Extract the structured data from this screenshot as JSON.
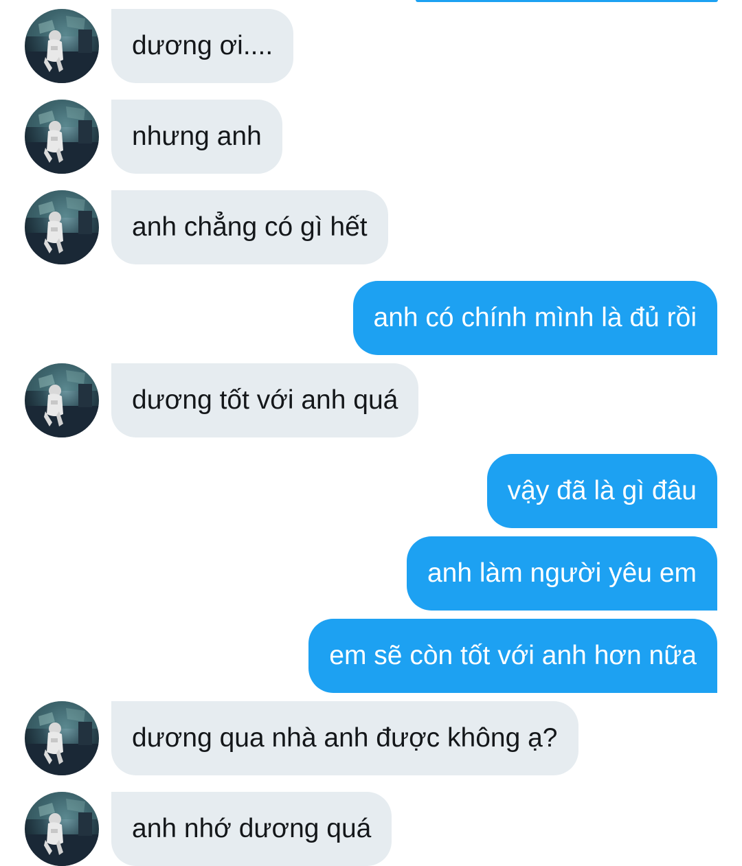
{
  "conversation": {
    "messages": [
      {
        "direction": "incoming",
        "text": "dương ơi...."
      },
      {
        "direction": "incoming",
        "text": "nhưng anh"
      },
      {
        "direction": "incoming",
        "text": "anh chẳng có gì hết"
      },
      {
        "direction": "outgoing",
        "text": "anh có chính mình là đủ rồi"
      },
      {
        "direction": "incoming",
        "text": "dương tốt với anh quá"
      },
      {
        "direction": "outgoing",
        "text": "vậy đã là gì đâu"
      },
      {
        "direction": "outgoing",
        "text": "anh làm người yêu em"
      },
      {
        "direction": "outgoing",
        "text": "em sẽ còn tốt với anh hơn nữa"
      },
      {
        "direction": "incoming",
        "text": "dương qua nhà anh được không ạ?"
      },
      {
        "direction": "incoming",
        "text": "anh nhớ dương quá"
      }
    ],
    "avatar_icon": "contact-avatar-photo"
  },
  "colors": {
    "incoming_bubble": "#e6ecf0",
    "incoming_text": "#14171a",
    "outgoing_bubble": "#1da1f2",
    "outgoing_text": "#ffffff"
  }
}
